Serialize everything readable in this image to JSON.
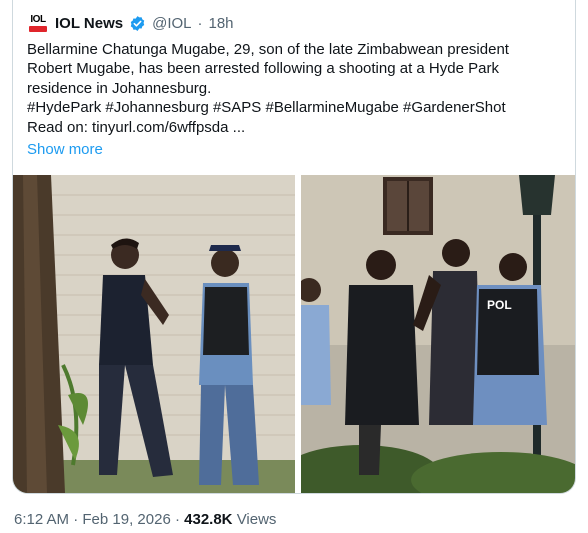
{
  "post": {
    "author_name": "IOL News",
    "handle": "@IOL",
    "separator": "·",
    "time_ago": "18h",
    "logo_text": "IOL",
    "lines": [
      "Bellarmine Chatunga Mugabe, 29, son of the late Zimbabwean president",
      "Robert Mugabe, has been arrested following a shooting at a Hyde Park",
      "residence in Johannesburg.",
      "#HydePark #Johannesburg #SAPS #BellarmineMugabe #GardenerShot",
      "Read on: tinyurl.com/6wffpsda ..."
    ],
    "show_more": "Show more",
    "vest_text": "POL"
  },
  "footer": {
    "time": "6:12 AM",
    "dot1": "·",
    "date": "Feb 19, 2026",
    "dot2": "·",
    "views_count": "432.8K",
    "views_label": "Views"
  },
  "colors": {
    "verified": "#1d9bf0",
    "link": "#1d9bf0",
    "logo_red": "#e0252b"
  }
}
